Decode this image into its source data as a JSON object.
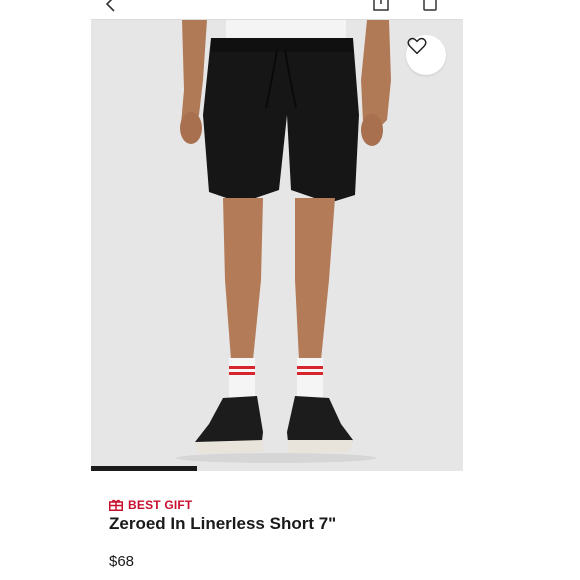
{
  "header": {
    "back_icon": "chevron-left-icon",
    "share_icon": "share-icon",
    "bag_icon": "shopping-bag-icon"
  },
  "gallery": {
    "image_subject": "black-shorts-on-model",
    "wishlist_icon": "heart-outline-icon",
    "indicator_progress": 0.285
  },
  "product": {
    "badge_icon": "gift-icon",
    "badge_label": "BEST GIFT",
    "title": "Zeroed In Linerless Short 7\"",
    "price": "$68"
  },
  "colors": {
    "badge_red": "#c8102e",
    "text_dark": "#1a1a1a",
    "image_background": "#e6e6e6"
  }
}
